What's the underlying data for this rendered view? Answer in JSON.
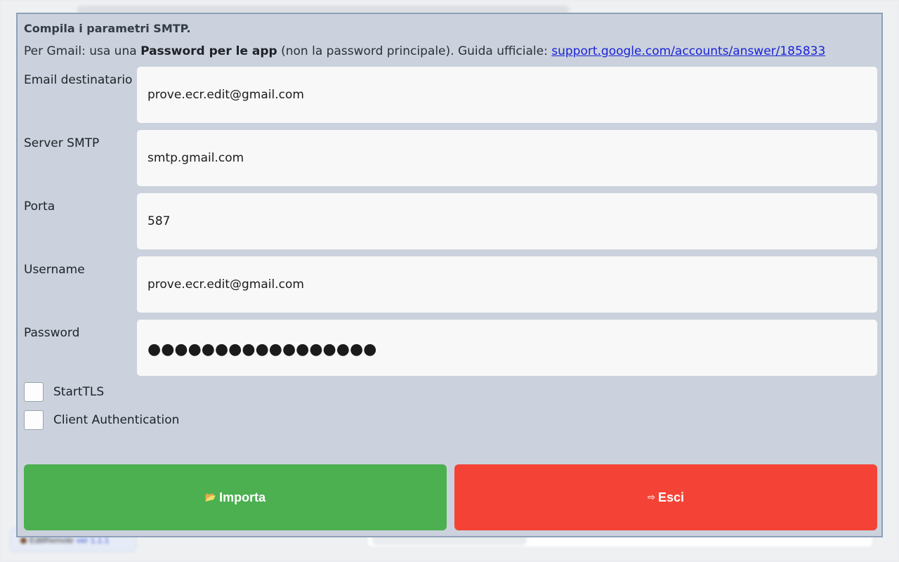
{
  "background": {
    "app_name": "EditRemote",
    "version": "ver 1.1.1"
  },
  "dialog": {
    "title": "Compila i parametri SMTP.",
    "hint_prefix": "Per Gmail: usa una ",
    "hint_bold": "Password per le app",
    "hint_middle": " (non la password principale). Guida ufficiale: ",
    "hint_link": "support.google.com/accounts/answer/185833",
    "fields": {
      "email": {
        "label": "Email destinatario",
        "value": "prove.ecr.edit@gmail.com"
      },
      "server": {
        "label": "Server SMTP",
        "value": "smtp.gmail.com"
      },
      "port": {
        "label": "Porta",
        "value": "587"
      },
      "username": {
        "label": "Username",
        "value": "prove.ecr.edit@gmail.com"
      },
      "password": {
        "label": "Password",
        "value": "●●●●●●●●●●●●●●●●●"
      }
    },
    "checkboxes": {
      "starttls": {
        "label": "StartTLS",
        "checked": false
      },
      "client_auth": {
        "label": "Client Authentication",
        "checked": false
      }
    },
    "buttons": {
      "import": {
        "icon": "📂",
        "label": "Importa",
        "color": "#4caf50"
      },
      "exit": {
        "icon": "⇨",
        "label": "Esci",
        "color": "#f44336"
      }
    }
  }
}
